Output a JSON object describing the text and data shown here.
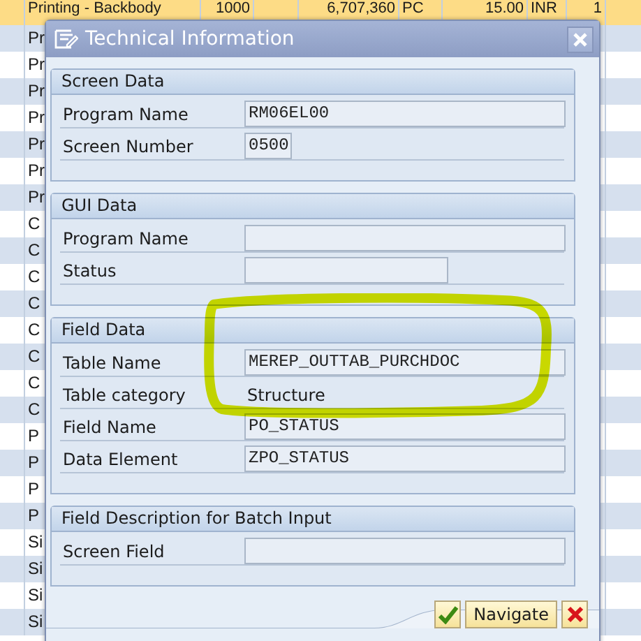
{
  "background_table": {
    "rows": [
      {
        "selected": true,
        "column_1": "Printing - Backbody",
        "column_2": "1000",
        "column_4": "6,707,360",
        "column_5": "PC",
        "column_6": "15.00",
        "column_7": "INR",
        "column_8": "1"
      },
      {
        "selected": false,
        "column_1": "Pr"
      },
      {
        "selected": false,
        "column_1": "Pr"
      },
      {
        "selected": false,
        "column_1": "Pr"
      },
      {
        "selected": false,
        "column_1": "Pr"
      },
      {
        "selected": false,
        "column_1": "Pr"
      },
      {
        "selected": false,
        "column_1": "Pr"
      },
      {
        "selected": false,
        "column_1": "Pr"
      },
      {
        "selected": false,
        "column_1": "C"
      },
      {
        "selected": false,
        "column_1": "C"
      },
      {
        "selected": false,
        "column_1": "C"
      },
      {
        "selected": false,
        "column_1": "C"
      },
      {
        "selected": false,
        "column_1": "C"
      },
      {
        "selected": false,
        "column_1": "C"
      },
      {
        "selected": false,
        "column_1": "C"
      },
      {
        "selected": false,
        "column_1": "C"
      },
      {
        "selected": false,
        "column_1": "P"
      },
      {
        "selected": false,
        "column_1": "P"
      },
      {
        "selected": false,
        "column_1": "P"
      },
      {
        "selected": false,
        "column_1": "P"
      },
      {
        "selected": false,
        "column_1": "Si"
      },
      {
        "selected": false,
        "column_1": "Si"
      },
      {
        "selected": false,
        "column_1": "Si"
      },
      {
        "selected": false,
        "column_1": "Si"
      }
    ]
  },
  "dialog": {
    "title": "Technical Information",
    "groups": [
      {
        "title": "Screen Data",
        "rows": [
          {
            "label": "Program Name",
            "kind": "long",
            "value": "RM06EL00"
          },
          {
            "label": "Screen Number",
            "kind": "short",
            "value": "0500"
          }
        ]
      },
      {
        "title": "GUI Data",
        "rows": [
          {
            "label": "Program Name",
            "kind": "long"
          },
          {
            "label": "Status",
            "kind": "medium"
          }
        ]
      },
      {
        "title": "Field Data",
        "rows": [
          {
            "label": "Table Name",
            "kind": "long",
            "value": "MEREP_OUTTAB_PURCHDOC"
          },
          {
            "label": "Table category",
            "kind": "text",
            "value": "Structure"
          },
          {
            "label": "Field Name",
            "kind": "long",
            "value": "PO_STATUS"
          },
          {
            "label": "Data Element",
            "kind": "long",
            "value": "ZPO_STATUS"
          }
        ]
      },
      {
        "title": "Field Description for Batch Input",
        "rows": [
          {
            "label": "Screen Field",
            "kind": "long"
          }
        ]
      }
    ],
    "buttons": [
      {
        "kind": "confirm"
      },
      {
        "kind": "text",
        "label": "Navigate"
      },
      {
        "kind": "cancel"
      }
    ]
  }
}
